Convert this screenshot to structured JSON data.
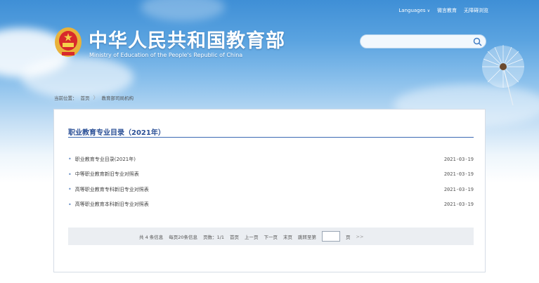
{
  "header": {
    "top_links": {
      "languages": "Languages",
      "weibo": "微言教育",
      "accessibility": "无障碍浏览"
    },
    "title": "中华人民共和国教育部",
    "subtitle": "Ministry of Education of the People's Republic of China",
    "search": {
      "placeholder": ""
    }
  },
  "breadcrumb": {
    "prefix": "当前位置：",
    "home": "首页",
    "current": "教育部司局机构"
  },
  "section": {
    "title": "职业教育专业目录（2021年）",
    "items": [
      {
        "title": "职业教育专业目录(2021年)",
        "date": "2021-03-19"
      },
      {
        "title": "中等职业教育新旧专业对照表",
        "date": "2021-03-19"
      },
      {
        "title": "高等职业教育专科新旧专业对照表",
        "date": "2021-03-19"
      },
      {
        "title": "高等职业教育本科新旧专业对照表",
        "date": "2021-03-19"
      }
    ]
  },
  "pager": {
    "total": "共 4 条信息",
    "per_page": "每页20条信息",
    "page_count": "页数：1/1",
    "first": "首页",
    "prev": "上一页",
    "next": "下一页",
    "last": "末页",
    "jump": "跳转至第",
    "page_unit": "页",
    "go": ">>"
  },
  "colors": {
    "accent": "#2a4f96",
    "rule": "#3b69b4",
    "pager_bg": "#ebeef2"
  },
  "icons": [
    "national-emblem-icon",
    "search-icon",
    "chevron-down-icon",
    "bullet-icon"
  ]
}
